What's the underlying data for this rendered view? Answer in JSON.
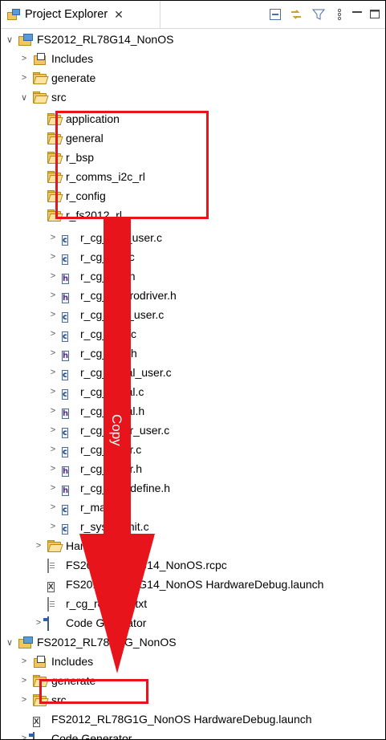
{
  "tab": {
    "title": "Project Explorer",
    "close": "✕",
    "icon": "project-explorer-icon"
  },
  "toolbar": {
    "icons": [
      "collapse-all-icon",
      "link-with-editor-icon",
      "filter-icon",
      "view-menu-icon",
      "minimize-icon",
      "maximize-icon"
    ]
  },
  "tree": {
    "project1": "FS2012_RL78G14_NonOS",
    "includes1": "Includes",
    "generate1": "generate",
    "src1": "src",
    "folders": [
      "application",
      "general",
      "r_bsp",
      "r_comms_i2c_rl",
      "r_config",
      "r_fs2012_rl"
    ],
    "files": [
      {
        "type": "c",
        "name": "r_cg_cgc_user.c"
      },
      {
        "type": "c",
        "name": "r_cg_cgc.c"
      },
      {
        "type": "h",
        "name": "r_cg_cgc.h"
      },
      {
        "type": "h",
        "name": "r_cg_macrodriver.h"
      },
      {
        "type": "c",
        "name": "r_cg_port_user.c"
      },
      {
        "type": "c",
        "name": "r_cg_port.c"
      },
      {
        "type": "h",
        "name": "r_cg_port.h"
      },
      {
        "type": "c",
        "name": "r_cg_serial_user.c"
      },
      {
        "type": "c",
        "name": "r_cg_serial.c"
      },
      {
        "type": "h",
        "name": "r_cg_serial.h"
      },
      {
        "type": "c",
        "name": "r_cg_timer_user.c"
      },
      {
        "type": "c",
        "name": "r_cg_timer.c"
      },
      {
        "type": "h",
        "name": "r_cg_timer.h"
      },
      {
        "type": "h",
        "name": "r_cg_userdefine.h"
      },
      {
        "type": "c",
        "name": "r_main.c"
      },
      {
        "type": "c",
        "name": "r_systeminit.c"
      }
    ],
    "hardwaredebug": "HardwareDebug",
    "rcpc": "FS2012_RL78G14_NonOS.rcpc",
    "launch1": "FS2012_RL78G14_NonOS HardwareDebug.launch",
    "readme": "r_cg_readme.txt",
    "codegen1": "Code Generator",
    "project2": "FS2012_RL78G1G_NonOS",
    "includes2": "Includes",
    "generate2": "generate",
    "src2": "src",
    "launch2": "FS2012_RL78G1G_NonOS HardwareDebug.launch",
    "codegen2": "Code Generator"
  },
  "annotation": {
    "label": "Copy",
    "color": "#e8141b"
  }
}
